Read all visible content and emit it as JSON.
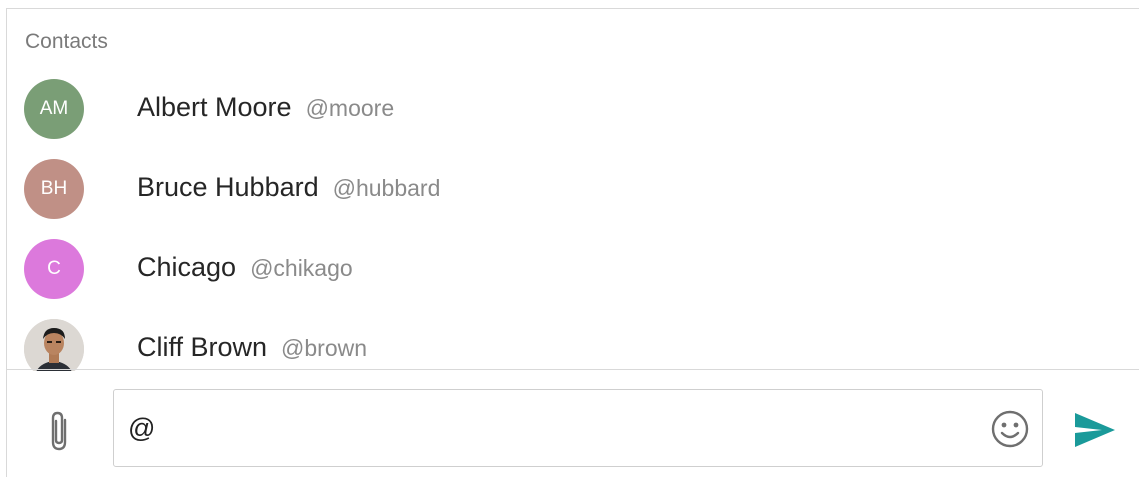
{
  "contacts": {
    "title": "Contacts",
    "items": [
      {
        "initials": "AM",
        "name": "Albert Moore",
        "handle": "@moore",
        "color": "#7a9e76"
      },
      {
        "initials": "BH",
        "name": "Bruce Hubbard",
        "handle": "@hubbard",
        "color": "#c09086"
      },
      {
        "initials": "C",
        "name": "Chicago",
        "handle": "@chikago",
        "color": "#dc79dc"
      },
      {
        "initials": "",
        "name": "Cliff Brown",
        "handle": "@brown",
        "color": "#d8d4d0",
        "avatar_type": "photo"
      }
    ]
  },
  "composer": {
    "value": "@",
    "attach_icon": "paperclip-icon",
    "emoji_icon": "smiley-icon",
    "send_icon": "send-icon",
    "send_color": "#1a9a9a"
  }
}
